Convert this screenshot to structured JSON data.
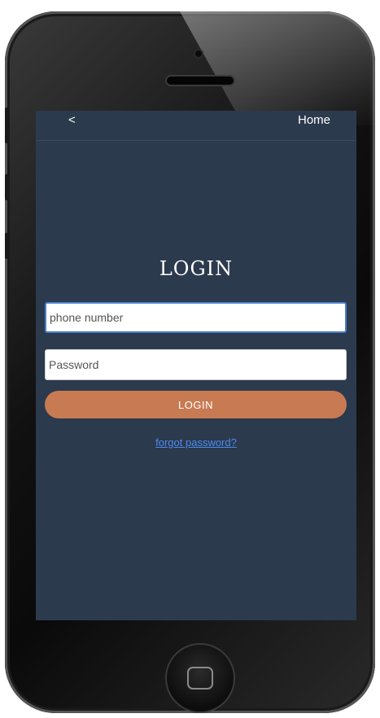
{
  "topbar": {
    "back_label": "<",
    "home_label": "Home"
  },
  "main": {
    "title": "LOGIN",
    "phone_placeholder": "phone number",
    "password_placeholder": "Password",
    "login_button_label": "LOGIN",
    "forgot_link_label": "forgot password?"
  },
  "colors": {
    "screen_background": "#2c3a4d",
    "login_button": "#c87b53",
    "link": "#4a8af0",
    "focus_border": "#4a7ec9"
  },
  "device": {
    "home_button_icon": "rounded-square-icon",
    "camera_icon": "camera-icon",
    "speaker_icon": "speaker-icon"
  }
}
